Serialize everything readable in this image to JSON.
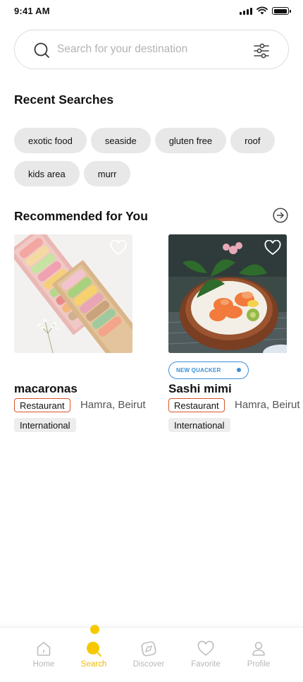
{
  "status_bar": {
    "time": "9:41 AM"
  },
  "search": {
    "placeholder": "Search for your destination",
    "value": ""
  },
  "recent": {
    "title": "Recent Searches",
    "chips": [
      "exotic food",
      "seaside",
      "gluten free",
      "roof",
      "kids area",
      "murr"
    ]
  },
  "recommended": {
    "title": "Recommended for You",
    "cards": [
      {
        "name": "macaronas",
        "type": "Restaurant",
        "location": "Hamra, Beirut",
        "cuisine": "International",
        "image_icon": "macarons-photo",
        "badge": ""
      },
      {
        "name": "Sashi mimi",
        "type": "Restaurant",
        "location": "Hamra, Beirut",
        "cuisine": "International",
        "image_icon": "sashimi-photo",
        "badge": "NEW QUACKER"
      }
    ]
  },
  "nav": {
    "items": [
      {
        "label": "Home",
        "icon": "home-icon"
      },
      {
        "label": "Search",
        "icon": "search-icon"
      },
      {
        "label": "Discover",
        "icon": "compass-icon"
      },
      {
        "label": "Favorite",
        "icon": "heart-icon"
      },
      {
        "label": "Profile",
        "icon": "profile-icon"
      }
    ],
    "active": "Search"
  },
  "colors": {
    "accent": "#f7c800",
    "badge_border": "#d9542c",
    "quacker_blue": "#3b8fd8",
    "chip_bg": "#e8e8e8",
    "nav_inactive": "#b8b8b8"
  }
}
